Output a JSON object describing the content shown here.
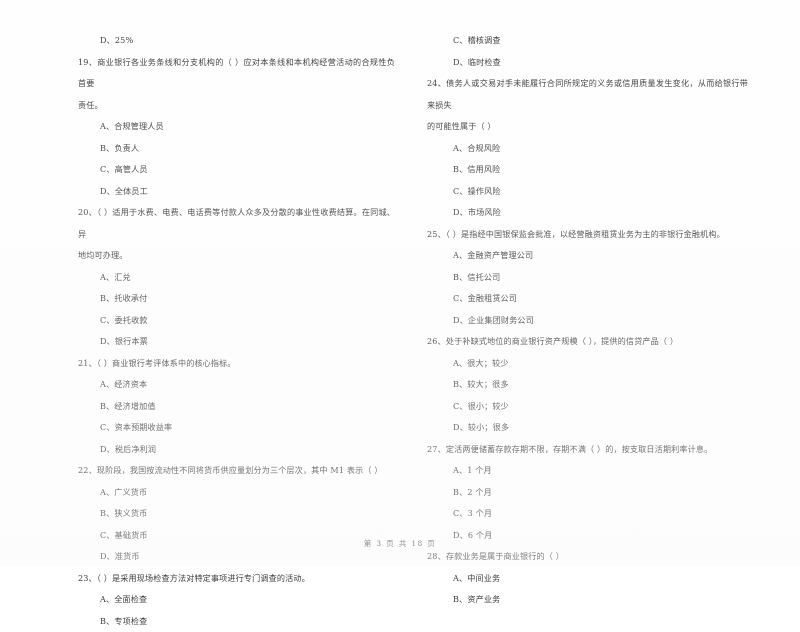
{
  "document": {
    "type": "exam-paper",
    "language": "zh-CN",
    "footer": "第 3 页 共 18 页"
  },
  "left_column": {
    "orphan_option": "D、25%",
    "questions": [
      {
        "number": "19、",
        "stem": "商业银行各业务条线和分支机构的（        ）应对本条线和本机构经营活动的合规性负首要",
        "stem_cont": "责任。",
        "options": [
          "A、合规管理人员",
          "B、负责人",
          "C、高管人员",
          "D、全体员工"
        ]
      },
      {
        "number": "20、",
        "stem": "（        ）适用于水费、电费、电话费等付款人众多及分散的事业性收费结算。在同城、异",
        "stem_cont": "地均可办理。",
        "options": [
          "A、汇兑",
          "B、托收承付",
          "C、委托收款",
          "D、银行本票"
        ]
      },
      {
        "number": "21、",
        "stem": "（        ）商业银行考评体系中的核心指标。",
        "stem_cont": "",
        "options": [
          "A、经济资本",
          "B、经济增加值",
          "C、资本预期收益率",
          "D、税后净利润"
        ]
      },
      {
        "number": "22、",
        "stem": "现阶段，我国按流动性不同将货币供应量划分为三个层次，其中 M1 表示（        ）",
        "stem_cont": "",
        "options": [
          "A、广义货币",
          "B、狭义货币",
          "C、基础货币",
          "D、准货币"
        ]
      },
      {
        "number": "23、",
        "stem": "（        ）是采用现场检查方法对特定事项进行专门调查的活动。",
        "stem_cont": "",
        "options": [
          "A、全面检查",
          "B、专项检查"
        ]
      }
    ]
  },
  "right_column": {
    "orphan_options": [
      "C、稽核调查",
      "D、临时检查"
    ],
    "questions": [
      {
        "number": "24、",
        "stem": "债务人或交易对手未能履行合同所规定的义务或信用质量发生变化，从而给银行带来损失",
        "stem_cont": "的可能性属于（        ）",
        "options": [
          "A、合规风险",
          "B、信用风险",
          "C、操作风险",
          "D、市场风险"
        ]
      },
      {
        "number": "25、",
        "stem": "（        ）是指经中国银保监会批准，以经营融资租赁业务为主的非银行金融机构。",
        "stem_cont": "",
        "options": [
          "A、金融资产管理公司",
          "B、信托公司",
          "C、金融租赁公司",
          "D、企业集团财务公司"
        ]
      },
      {
        "number": "26、",
        "stem": "处于补缺式地位的商业银行资产规模（        ），提供的信贷产品（        ）",
        "stem_cont": "",
        "options": [
          "A、很大；较少",
          "B、较大；很多",
          "C、很小；较少",
          "D、较小；很多"
        ]
      },
      {
        "number": "27、",
        "stem": "定活两便储蓄存款存期不限，存期不满（        ）的，按支取日活期利率计息。",
        "stem_cont": "",
        "options": [
          "A、1 个月",
          "B、2 个月",
          "C、3 个月",
          "D、6 个月"
        ]
      },
      {
        "number": "28、",
        "stem": "存款业务是属于商业银行的（        ）",
        "stem_cont": "",
        "options": [
          "A、中间业务",
          "B、资产业务"
        ]
      }
    ]
  }
}
